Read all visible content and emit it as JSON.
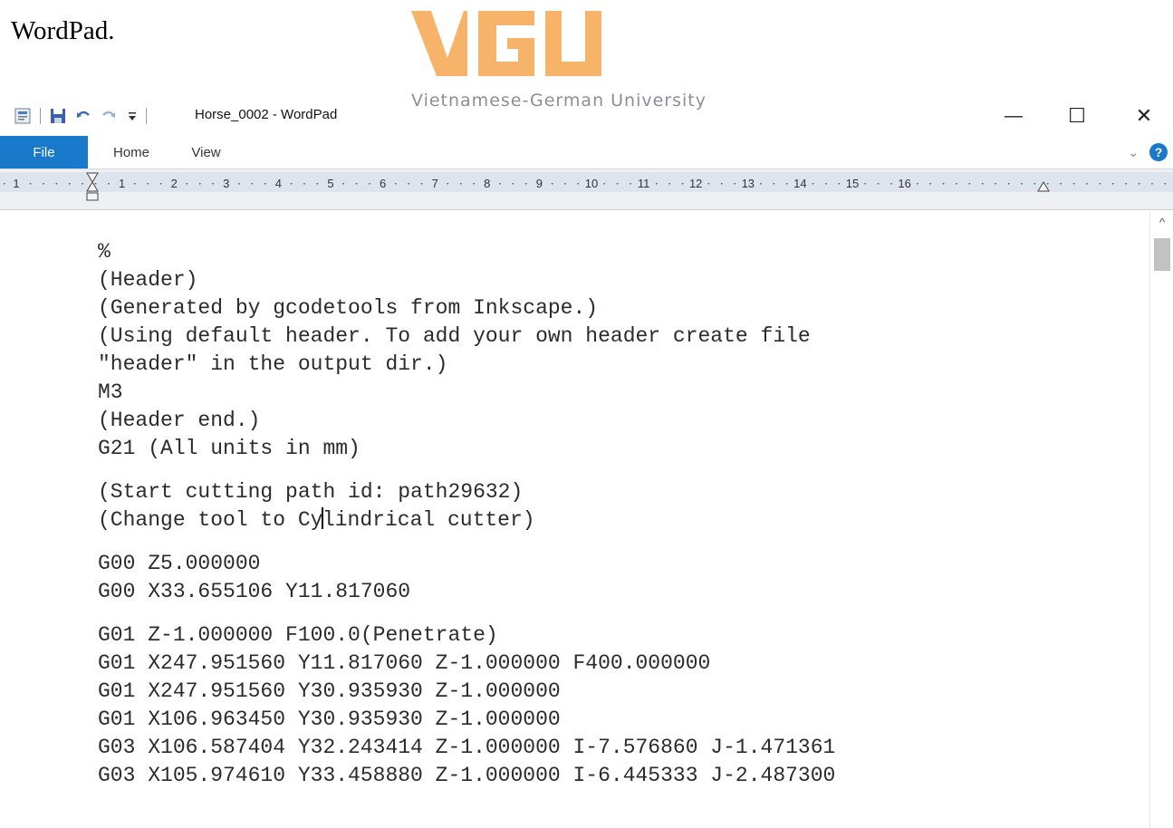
{
  "caption": "WordPad.",
  "logo": {
    "letters": "VGU",
    "subtitle": "Vietnamese-German University",
    "color": "#f7b36a"
  },
  "titlebar": {
    "title": "Horse_0002 - WordPad",
    "qat_icons": [
      "wordpad-app-icon",
      "save-icon",
      "undo-icon",
      "redo-icon",
      "customize-qat-icon"
    ],
    "minimize": "—",
    "maximize": "☐",
    "close": "✕"
  },
  "ribbon": {
    "tabs": [
      "File",
      "Home",
      "View"
    ],
    "collapse": "⌄",
    "help": "?",
    "accent": "#1979ca"
  },
  "ruler": {
    "labels": [
      "1",
      "1",
      "2",
      "3",
      "4",
      "5",
      "6",
      "7",
      "8",
      "9",
      "10",
      "11",
      "12",
      "13",
      "14",
      "15",
      "16"
    ]
  },
  "document": {
    "lines": [
      "%",
      "(Header)",
      "(Generated by gcodetools from Inkscape.)",
      "(Using default header. To add your own header create file",
      "\"header\" in the output dir.)",
      "M3",
      "(Header end.)",
      "G21 (All units in mm)",
      "",
      "(Start cutting path id: path29632)",
      "(Change tool to Cylindrical cutter)",
      "",
      "G00 Z5.000000",
      "G00 X33.655106 Y11.817060",
      "",
      "G01 Z-1.000000 F100.0(Penetrate)",
      "G01 X247.951560 Y11.817060 Z-1.000000 F400.000000",
      "G01 X247.951560 Y30.935930 Z-1.000000",
      "G01 X106.963450 Y30.935930 Z-1.000000",
      "G03 X106.587404 Y32.243414 Z-1.000000 I-7.576860 J-1.471361",
      "G03 X105.974610 Y33.458880 Z-1.000000 I-6.445333 J-2.487300"
    ]
  },
  "scrollbar": {
    "up_arrow": "^"
  }
}
